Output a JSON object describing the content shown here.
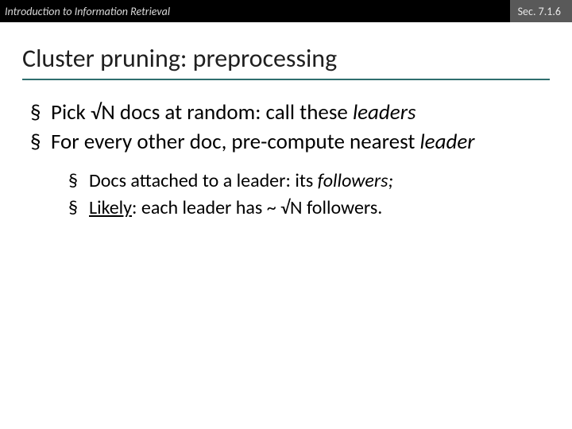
{
  "header": {
    "left": "Introduction to Information Retrieval",
    "right": "Sec. 7.1.6"
  },
  "title": "Cluster pruning: preprocessing",
  "bullets": {
    "b1_pre": "Pick √N docs at random: call these ",
    "b1_em": "leaders",
    "b2": "For every other doc, pre-compute nearest ",
    "b2_em": "leader",
    "s1_pre": "Docs attached to a leader: its ",
    "s1_em": "followers;",
    "s2_u": "Likely",
    "s2_rest": ": each leader has ~ √N followers."
  }
}
